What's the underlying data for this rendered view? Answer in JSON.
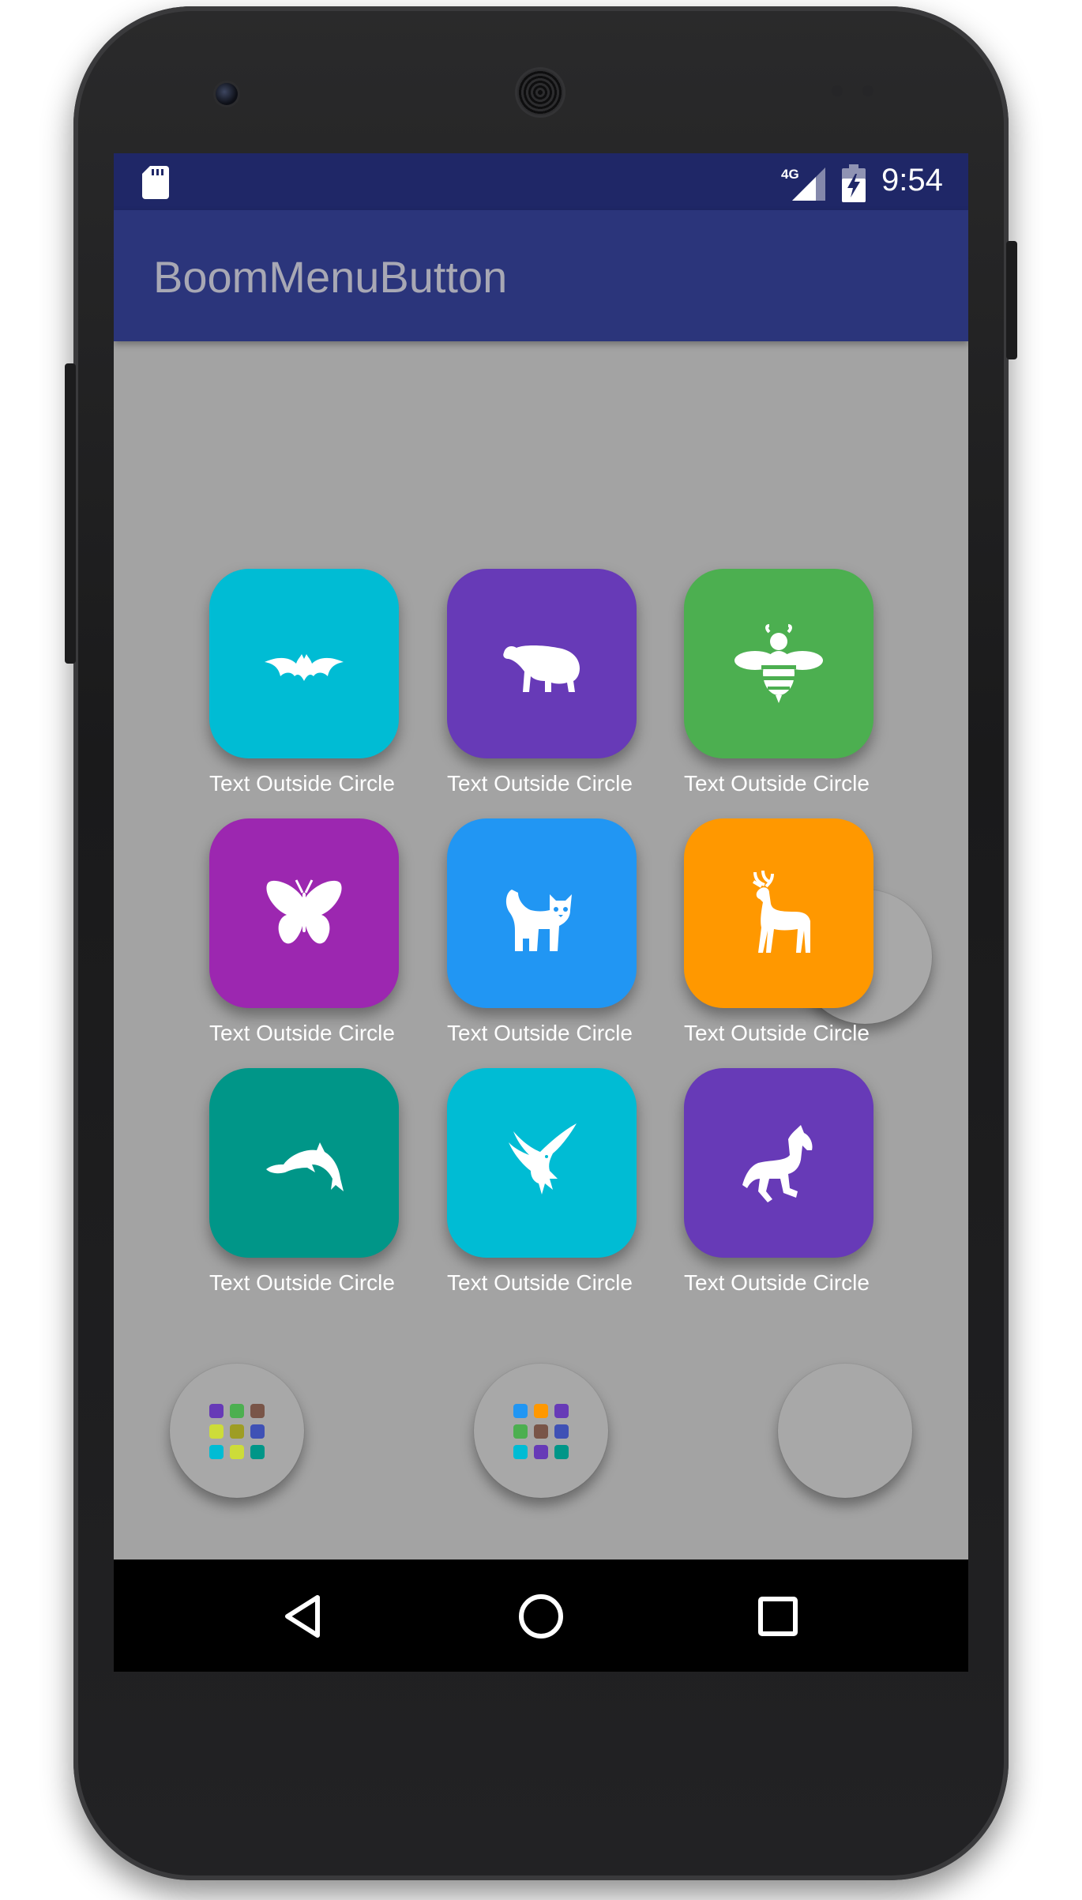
{
  "status_bar": {
    "time": "9:54",
    "network": "4G",
    "icons": [
      "sd-card-icon",
      "signal-icon",
      "battery-charging-icon"
    ],
    "background": "#1f2767"
  },
  "app_bar": {
    "title": "BoomMenuButton",
    "background": "#2b357b"
  },
  "tiles": [
    {
      "label": "Text Outside Circle",
      "icon": "bat-icon",
      "color": "#00bcd4"
    },
    {
      "label": "Text Outside Circle",
      "icon": "polar-bear-icon",
      "color": "#673ab7"
    },
    {
      "label": "Text Outside Circle",
      "icon": "bee-icon",
      "color": "#4caf50"
    },
    {
      "label": "Text Outside Circle",
      "icon": "butterfly-icon",
      "color": "#9c27b0"
    },
    {
      "label": "Text Outside Circle",
      "icon": "cat-icon",
      "color": "#2196f3"
    },
    {
      "label": "Text Outside Circle",
      "icon": "deer-icon",
      "color": "#ff9800"
    },
    {
      "label": "Text Outside Circle",
      "icon": "dolphin-icon",
      "color": "#009688"
    },
    {
      "label": "Text Outside Circle",
      "icon": "eagle-icon",
      "color": "#00bcd4"
    },
    {
      "label": "Text Outside Circle",
      "icon": "horse-icon",
      "color": "#673ab7"
    }
  ],
  "boom_buttons": [
    {
      "name": "boom-button-left",
      "icon": "grid-dots-icon",
      "dot_colors": [
        "#673ab7",
        "#4caf50",
        "#795548",
        "#cddc39",
        "#9e9d24",
        "#3f51b5",
        "#00bcd4",
        "#cddc39",
        "#009688"
      ]
    },
    {
      "name": "boom-button-center",
      "icon": "grid-dots-icon",
      "dot_colors": [
        "#2196f3",
        "#ff9800",
        "#673ab7",
        "#4caf50",
        "#795548",
        "#3f51b5",
        "#00bcd4",
        "#673ab7",
        "#009688"
      ]
    },
    {
      "name": "boom-button-right",
      "icon": "none"
    }
  ],
  "nav_bar": {
    "buttons": [
      "back-icon",
      "home-icon",
      "recents-icon"
    ]
  }
}
